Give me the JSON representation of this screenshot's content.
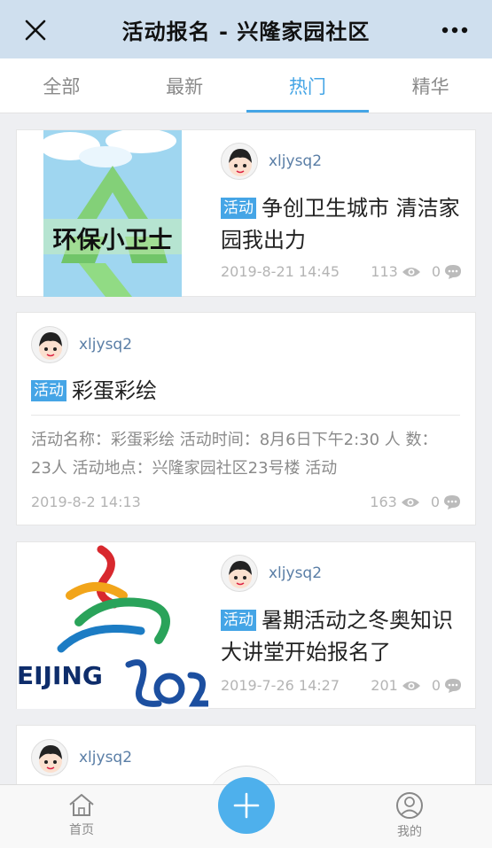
{
  "header": {
    "title": "活动报名 - 兴隆家园社区"
  },
  "tabs": [
    {
      "label": "全部"
    },
    {
      "label": "最新"
    },
    {
      "label": "热门",
      "active": true
    },
    {
      "label": "精华"
    }
  ],
  "posts": [
    {
      "author": "xljysq2",
      "badge": "活动",
      "title": "争创卫生城市 清洁家园我出力",
      "date": "2019-8-21 14:45",
      "views": "113",
      "comments": "0",
      "thumb_text": "环保小卫士"
    },
    {
      "author": "xljysq2",
      "badge": "活动",
      "title": "彩蛋彩绘",
      "excerpt": "活动名称：彩蛋彩绘 活动时间：8月6日下午2:30 人 数：23人 活动地点：兴隆家园社区23号楼 活动",
      "date": "2019-8-2 14:13",
      "views": "163",
      "comments": "0"
    },
    {
      "author": "xljysq2",
      "badge": "活动",
      "title": "暑期活动之冬奥知识大讲堂开始报名了",
      "date": "2019-7-26 14:27",
      "views": "201",
      "comments": "0",
      "thumb_text": "EIJING"
    },
    {
      "author": "xljysq2"
    }
  ],
  "bottom_nav": {
    "home": "首页",
    "mine": "我的"
  },
  "colors": {
    "accent": "#45a5e6",
    "header_bg": "#cfdfee",
    "badge_bg": "#45a5e6"
  },
  "icons": {
    "close": "close-icon",
    "more": "more-dots-icon",
    "views": "eye-icon",
    "comments": "comment-bubble-icon",
    "home": "home-icon",
    "mine": "user-icon",
    "add": "plus-icon"
  }
}
